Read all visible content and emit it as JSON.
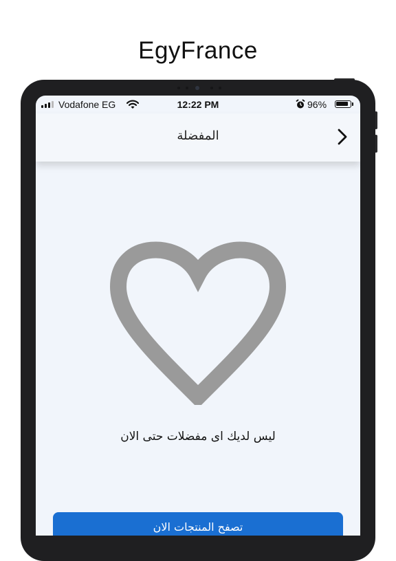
{
  "store_caption": "EgyFrance",
  "status_bar": {
    "carrier": "Vodafone EG",
    "time": "12:22 PM",
    "battery_percent": "96%",
    "battery_level": 0.96,
    "signal_bars": 3,
    "icons": [
      "signal-icon",
      "wifi-icon",
      "alarm-icon",
      "battery-icon"
    ]
  },
  "nav": {
    "title": "المفضلة",
    "back_icon": "chevron-right-icon"
  },
  "empty_state": {
    "icon": "heart-outline-icon",
    "message": "ليس لديك اى مفضلات حتى الان"
  },
  "primary_button": {
    "label": "تصفح المنتجات الان"
  },
  "colors": {
    "accent": "#1a6fd2",
    "heart": "#9a9a9a",
    "screen_background": "#f1f5fb",
    "device_frame": "#1f1f21"
  }
}
